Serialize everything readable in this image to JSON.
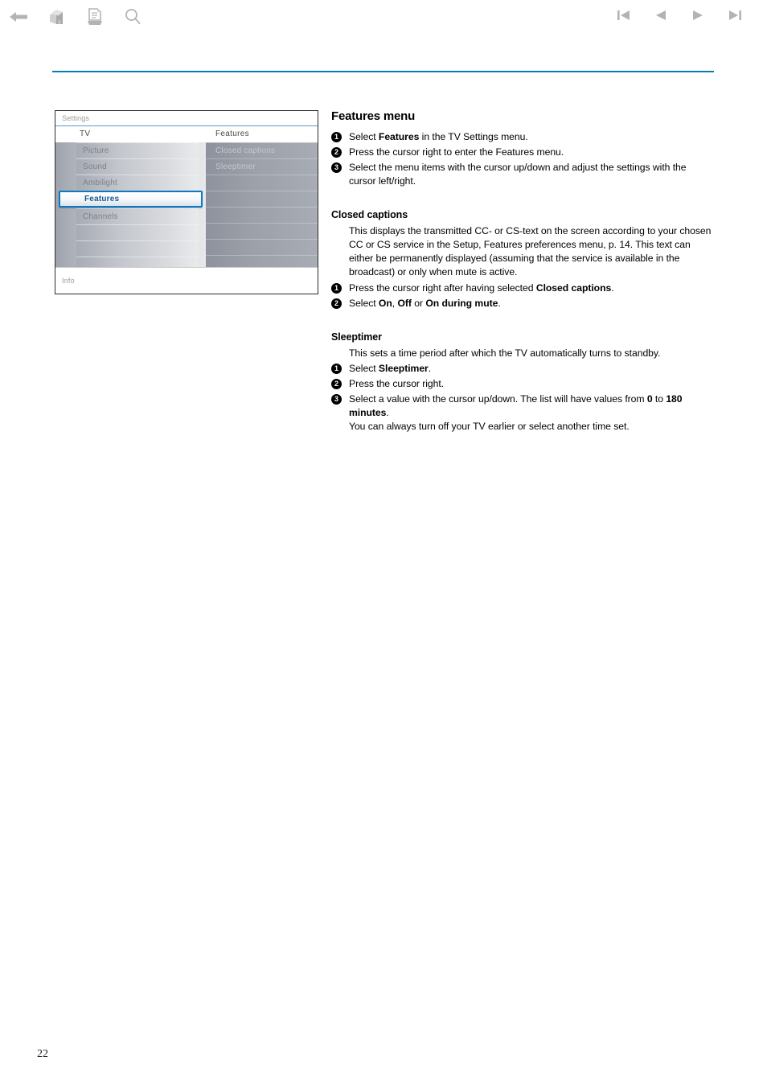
{
  "toolbar": {
    "left_icons": [
      {
        "name": "back-arrow-icon",
        "label": "Back"
      },
      {
        "name": "home-icon",
        "label": "Home"
      },
      {
        "name": "document-print-icon",
        "label": "Print"
      },
      {
        "name": "search-icon",
        "label": "Search"
      }
    ],
    "right_icons": [
      {
        "name": "first-page-icon",
        "label": "First page"
      },
      {
        "name": "previous-page-icon",
        "label": "Previous page"
      },
      {
        "name": "next-page-icon",
        "label": "Next page"
      },
      {
        "name": "last-page-icon",
        "label": "Last page"
      }
    ],
    "accent_color": "#0b79b3",
    "icon_color": "#b3b3b3"
  },
  "tv_menu_screenshot": {
    "window_title": "Settings",
    "left_column": {
      "header": "TV",
      "items": [
        {
          "label": "Picture",
          "selected": false
        },
        {
          "label": "Sound",
          "selected": false
        },
        {
          "label": "Ambilight",
          "selected": false
        },
        {
          "label": "Features",
          "selected": true
        },
        {
          "label": "Channels",
          "selected": false
        },
        {
          "label": "",
          "selected": false
        },
        {
          "label": "",
          "selected": false
        },
        {
          "label": "",
          "selected": false
        }
      ]
    },
    "right_column": {
      "header": "Features",
      "items": [
        {
          "label": "Closed captions"
        },
        {
          "label": "Sleeptimer"
        },
        {
          "label": ""
        },
        {
          "label": ""
        },
        {
          "label": ""
        },
        {
          "label": ""
        },
        {
          "label": ""
        },
        {
          "label": ""
        }
      ]
    },
    "info_bar": "Info",
    "highlight_color": "#0b79c4"
  },
  "article": {
    "title": "Features menu",
    "intro_steps": [
      {
        "num": "1",
        "html": "Select <b>Features</b> in the TV Settings menu."
      },
      {
        "num": "2",
        "html": "Press the cursor right to enter the Features menu."
      },
      {
        "num": "3",
        "html": "Select the menu items with the cursor up/down and adjust the settings with the cursor left/right."
      }
    ],
    "closed_captions": {
      "heading": "Closed captions",
      "paragraph": "This displays the transmitted CC- or CS-text on the screen according to your chosen CC or CS service in the Setup, Features preferences menu, p. 14. This text can either be permanently displayed (assuming that the service is available in the broadcast) or only when mute is active.",
      "steps": [
        {
          "num": "1",
          "html": "Press the cursor right after having selected <b>Closed captions</b>."
        },
        {
          "num": "2",
          "html": "Select <b>On</b>, <b>Off</b> or <b>On during mute</b>."
        }
      ]
    },
    "sleeptimer": {
      "heading": "Sleeptimer",
      "paragraph": "This sets a time period after which the TV automatically turns to standby.",
      "steps": [
        {
          "num": "1",
          "html": "Select <b>Sleeptimer</b>."
        },
        {
          "num": "2",
          "html": "Press the cursor right."
        },
        {
          "num": "3",
          "html": "Select a value with the cursor up/down. The list will have values from <b>0</b> to <b>180 minutes</b>.<br>You can always turn off your TV earlier or select another time set."
        }
      ]
    }
  },
  "page_number": "22"
}
